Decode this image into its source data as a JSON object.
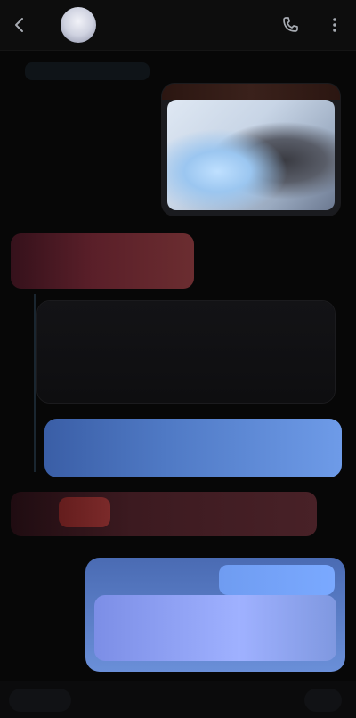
{
  "header": {
    "name": "",
    "subtitle": ""
  },
  "thread": {
    "date_label": "",
    "media_caption": "",
    "incoming_line1": "",
    "incoming_line2": "",
    "reply_head": "",
    "reply_body": "",
    "blue_text": "",
    "alert_text": "",
    "sub_label": "",
    "attachment_label": ""
  },
  "icons": {
    "back": "back-arrow-icon",
    "call": "call-icon",
    "menu": "more-icon"
  },
  "colors": {
    "background": "#070707",
    "accent_blue": "#4f79c4",
    "accent_red": "#5a1f29"
  }
}
